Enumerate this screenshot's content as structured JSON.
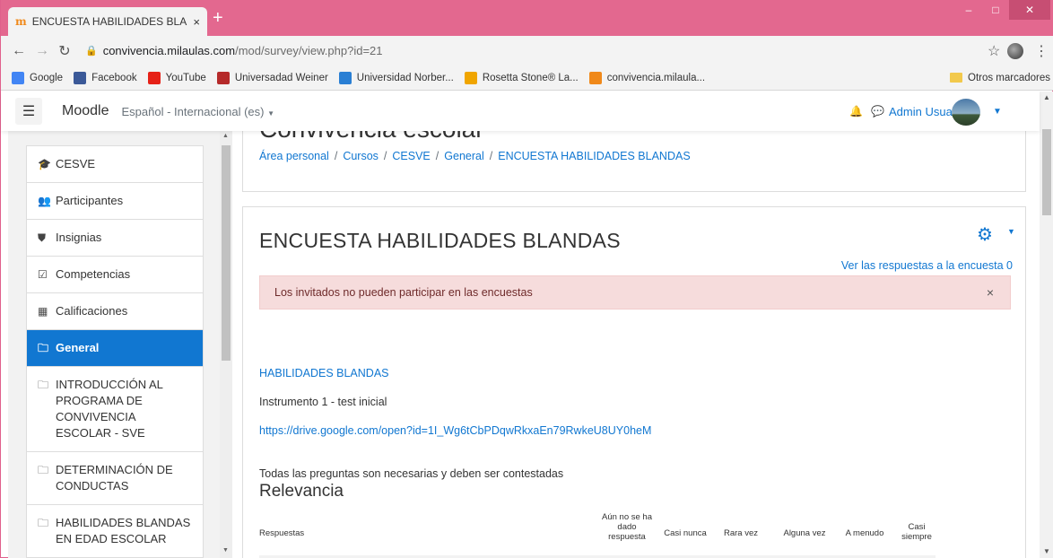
{
  "browser": {
    "tab_title": "ENCUESTA HABILIDADES BLAND",
    "tab_close": "×",
    "new_tab": "+",
    "url_domain": "convivencia.milaulas.com",
    "url_path": "/mod/survey/view.php?id=21",
    "window_controls": {
      "minimize": "–",
      "maximize": "□",
      "close": "✕"
    },
    "bookmarks": [
      {
        "label": "Google",
        "icon": "google-icon",
        "color": "#4285f4"
      },
      {
        "label": "Facebook",
        "icon": "facebook-icon",
        "color": "#3b5998"
      },
      {
        "label": "YouTube",
        "icon": "youtube-icon",
        "color": "#e62117"
      },
      {
        "label": "Universadad Weiner",
        "icon": "weiner-icon",
        "color": "#b52a2a"
      },
      {
        "label": "Universidad Norber...",
        "icon": "norbert-icon",
        "color": "#2a7fd4"
      },
      {
        "label": "Rosetta Stone® La...",
        "icon": "rosetta-icon",
        "color": "#f0a500"
      },
      {
        "label": "convivencia.milaula...",
        "icon": "moodle-icon",
        "color": "#f0891a"
      }
    ],
    "other_bookmarks": "Otros marcadores"
  },
  "moodle": {
    "brand": "Moodle",
    "language": "Español - Internacional (es)",
    "user_name": "Admin Usuario"
  },
  "sidebar": {
    "items": [
      {
        "label": "CESVE",
        "icon": "graduation-cap-icon",
        "glyph": "🎓",
        "active": false
      },
      {
        "label": "Participantes",
        "icon": "users-icon",
        "glyph": "👥",
        "active": false
      },
      {
        "label": "Insignias",
        "icon": "shield-icon",
        "glyph": "⛊",
        "active": false
      },
      {
        "label": "Competencias",
        "icon": "checkbox-icon",
        "glyph": "☑",
        "active": false
      },
      {
        "label": "Calificaciones",
        "icon": "table-icon",
        "glyph": "▦",
        "active": false
      },
      {
        "label": "General",
        "icon": "folder-icon",
        "glyph": "🗀",
        "active": true
      },
      {
        "label": "INTRODUCCIÓN AL PROGRAMA DE CONVIVENCIA ESCOLAR - SVE",
        "icon": "folder-icon",
        "glyph": "🗀",
        "active": false
      },
      {
        "label": "DETERMINACIÓN DE CONDUCTAS",
        "icon": "folder-icon",
        "glyph": "🗀",
        "active": false
      },
      {
        "label": "HABILIDADES BLANDAS EN EDAD ESCOLAR",
        "icon": "folder-icon",
        "glyph": "🗀",
        "active": false
      }
    ]
  },
  "main": {
    "course_title": "Convivencia escolar",
    "breadcrumb": [
      "Área personal",
      "Cursos",
      "CESVE",
      "General",
      "ENCUESTA HABILIDADES BLANDAS"
    ],
    "heading": "ENCUESTA HABILIDADES BLANDAS",
    "view_responses": "Ver las respuestas a la encuesta 0",
    "alert": "Los invitados no pueden participar en las encuestas",
    "alert_close": "×",
    "intro_link": "HABILIDADES BLANDAS",
    "intro_text": "Instrumento 1 - test inicial",
    "drive_link": "https://drive.google.com/open?id=1I_Wg6tCbPDqwRkxaEn79RwkeU8UY0heM",
    "required_note": "Todas las preguntas son necesarias y deben ser contestadas",
    "section_title": "Relevancia",
    "table_headers": [
      "Respuestas",
      "Aún no se ha dado respuesta",
      "Casi nunca",
      "Rara vez",
      "Alguna vez",
      "A menudo",
      "Casi siempre"
    ]
  }
}
